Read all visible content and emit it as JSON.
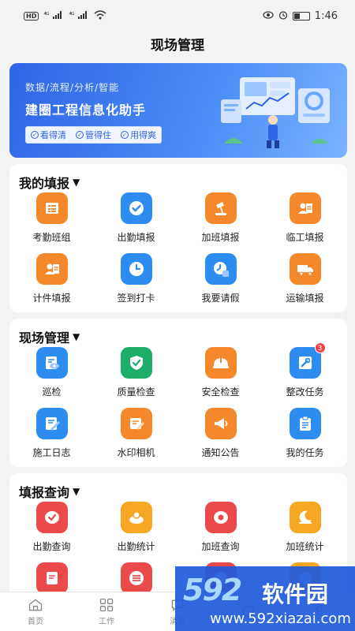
{
  "status_bar": {
    "time": "1:46",
    "hd_label": "HD",
    "sig1": "⁴ᴳ",
    "sig2": "⁴ᴳ"
  },
  "page": {
    "title": "现场管理"
  },
  "banner": {
    "subtitle": "数据/流程/分析/智能",
    "title": "建圈工程信息化助手",
    "chips": [
      "看得清",
      "管得住",
      "用得爽"
    ]
  },
  "sections": [
    {
      "title": "我的填报",
      "items": [
        {
          "label": "考勤班组",
          "icon": "roster-icon",
          "color": "#f5882a"
        },
        {
          "label": "出勤填报",
          "icon": "check-circle-icon",
          "color": "#2d8cf0"
        },
        {
          "label": "加班填报",
          "icon": "desk-lamp-icon",
          "color": "#f5882a"
        },
        {
          "label": "临工填报",
          "icon": "worker-card-icon",
          "color": "#f5882a"
        },
        {
          "label": "计件填报",
          "icon": "piece-card-icon",
          "color": "#f5882a"
        },
        {
          "label": "签到打卡",
          "icon": "clock-icon",
          "color": "#2d8cf0"
        },
        {
          "label": "我要请假",
          "icon": "leave-clock-icon",
          "color": "#2d8cf0"
        },
        {
          "label": "运输填报",
          "icon": "truck-icon",
          "color": "#f5882a"
        }
      ]
    },
    {
      "title": "现场管理",
      "items": [
        {
          "label": "巡检",
          "icon": "inspect-eye-icon",
          "color": "#2d8cf0"
        },
        {
          "label": "质量检查",
          "icon": "shield-check-icon",
          "color": "#1fae6a"
        },
        {
          "label": "安全检查",
          "icon": "helmet-icon",
          "color": "#f5882a"
        },
        {
          "label": "整改任务",
          "icon": "wrench-doc-icon",
          "color": "#2d8cf0",
          "badge": "3"
        },
        {
          "label": "施工日志",
          "icon": "log-pen-icon",
          "color": "#2d8cf0"
        },
        {
          "label": "水印相机",
          "icon": "stamp-camera-icon",
          "color": "#f5882a"
        },
        {
          "label": "通知公告",
          "icon": "megaphone-icon",
          "color": "#f5882a"
        },
        {
          "label": "我的任务",
          "icon": "clipboard-icon",
          "color": "#2d8cf0"
        }
      ]
    },
    {
      "title": "填报查询",
      "items": [
        {
          "label": "出勤查询",
          "icon": "attendance-query-icon",
          "color": "#ea4a4a"
        },
        {
          "label": "出勤统计",
          "icon": "attendance-stats-icon",
          "color": "#f5a623"
        },
        {
          "label": "加班查询",
          "icon": "overtime-query-icon",
          "color": "#ea4a4a"
        },
        {
          "label": "加班统计",
          "icon": "overtime-stats-icon",
          "color": "#f5a623"
        },
        {
          "label": "",
          "icon": "doc-query-icon",
          "color": "#ea4a4a"
        },
        {
          "label": "",
          "icon": "list-stats-icon",
          "color": "#ea4a4a"
        },
        {
          "label": "",
          "icon": "more-query-icon",
          "color": "#ea4a4a"
        },
        {
          "label": "",
          "icon": "more-stats-icon",
          "color": "#f5a623"
        }
      ]
    }
  ],
  "tab_bar": [
    {
      "label": "首页",
      "icon": "home-icon"
    },
    {
      "label": "工作",
      "icon": "grid-icon"
    },
    {
      "label": "消息",
      "icon": "message-icon"
    },
    {
      "label": "",
      "icon": "scan-icon"
    },
    {
      "label": "",
      "icon": "profile-icon"
    }
  ],
  "watermark": {
    "logo": "592",
    "text": "软件园",
    "url": "www.592xiazai.com"
  }
}
